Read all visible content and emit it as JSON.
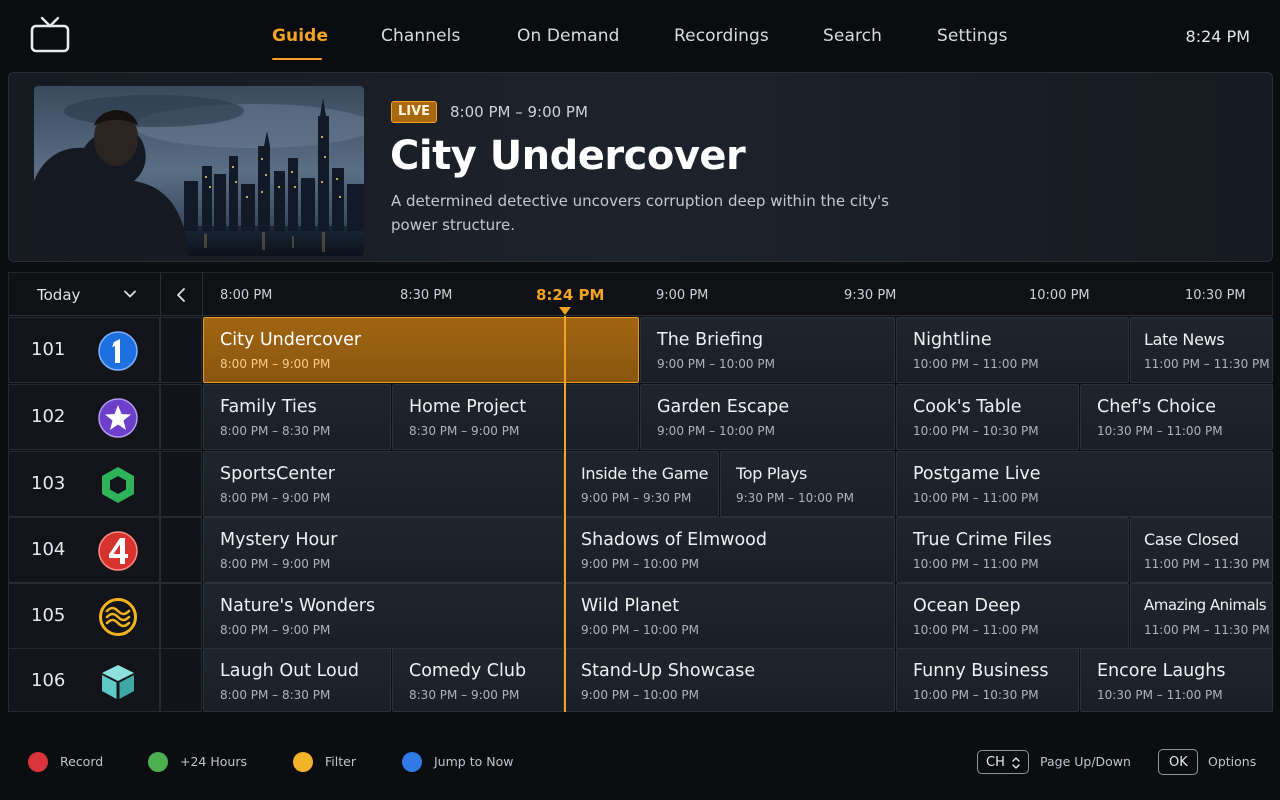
{
  "app": {
    "icon": "tv-icon",
    "clock": "8:24 PM"
  },
  "nav": {
    "items": [
      {
        "label": "Guide",
        "active": true
      },
      {
        "label": "Channels",
        "active": false
      },
      {
        "label": "On Demand",
        "active": false
      },
      {
        "label": "Recordings",
        "active": false
      },
      {
        "label": "Search",
        "active": false
      },
      {
        "label": "Settings",
        "active": false
      }
    ]
  },
  "featured": {
    "badge": "LIVE",
    "time": "8:00 PM – 9:00 PM",
    "title": "City Undercover",
    "description": "A determined detective uncovers corruption deep within the city's power structure."
  },
  "guide": {
    "day": "Today",
    "time_slots": [
      "8:00 PM",
      "8:30 PM",
      "9:00 PM",
      "9:30 PM",
      "10:00 PM",
      "10:30 PM"
    ],
    "now_label": "8:24 PM",
    "channels": [
      {
        "number": "101",
        "logo": "channel-1-logo",
        "logo_color": "#1e6fe0",
        "programs": [
          {
            "title": "City Undercover",
            "time": "8:00 PM – 9:00 PM",
            "selected": true
          },
          {
            "title": "The Briefing",
            "time": "9:00 PM – 10:00 PM"
          },
          {
            "title": "Nightline",
            "time": "10:00 PM – 11:00 PM"
          },
          {
            "title": "Late News",
            "time": "11:00 PM – 11:30 PM"
          }
        ]
      },
      {
        "number": "102",
        "logo": "star-channel-logo",
        "logo_color": "#6b3fc9",
        "programs": [
          {
            "title": "Family Ties",
            "time": "8:00 PM – 8:30 PM"
          },
          {
            "title": "Home Project",
            "time": "8:30 PM – 9:00 PM"
          },
          {
            "title": "Garden Escape",
            "time": "9:00 PM – 10:00 PM"
          },
          {
            "title": "Cook's Table",
            "time": "10:00 PM – 10:30 PM"
          },
          {
            "title": "Chef's Choice",
            "time": "10:30 PM – 11:00 PM"
          }
        ]
      },
      {
        "number": "103",
        "logo": "hexagon-channel-logo",
        "logo_color": "#2fb35a",
        "programs": [
          {
            "title": "SportsCenter",
            "time": "8:00 PM – 9:00 PM"
          },
          {
            "title": "Inside the Game",
            "time": "9:00 PM – 9:30 PM"
          },
          {
            "title": "Top Plays",
            "time": "9:30 PM – 10:00 PM"
          },
          {
            "title": "Postgame Live",
            "time": "10:00 PM – 11:00 PM"
          }
        ]
      },
      {
        "number": "104",
        "logo": "channel-4-logo",
        "logo_color": "#d6322e",
        "programs": [
          {
            "title": "Mystery Hour",
            "time": "8:00 PM – 9:00 PM"
          },
          {
            "title": "Shadows of Elmwood",
            "time": "9:00 PM – 10:00 PM"
          },
          {
            "title": "True Crime Files",
            "time": "10:00 PM – 11:00 PM"
          },
          {
            "title": "Case Closed",
            "time": "11:00 PM – 11:30 PM"
          }
        ]
      },
      {
        "number": "105",
        "logo": "waves-channel-logo",
        "logo_color": "#f2b320",
        "programs": [
          {
            "title": "Nature's Wonders",
            "time": "8:00 PM – 9:00 PM"
          },
          {
            "title": "Wild Planet",
            "time": "9:00 PM – 10:00 PM"
          },
          {
            "title": "Ocean Deep",
            "time": "10:00 PM – 11:00 PM"
          },
          {
            "title": "Amazing Animals",
            "time": "11:00 PM – 11:30 PM"
          }
        ]
      },
      {
        "number": "106",
        "logo": "cube-channel-logo",
        "logo_color": "#5fc9c6",
        "programs": [
          {
            "title": "Laugh Out Loud",
            "time": "8:00 PM – 8:30 PM"
          },
          {
            "title": "Comedy Club",
            "time": "8:30 PM – 9:00 PM"
          },
          {
            "title": "Stand-Up Showcase",
            "time": "9:00 PM – 10:00 PM"
          },
          {
            "title": "Funny Business",
            "time": "10:00 PM – 10:30 PM"
          },
          {
            "title": "Encore Laughs",
            "time": "10:30 PM – 11:00 PM"
          }
        ]
      }
    ]
  },
  "footer": {
    "hints": [
      {
        "color": "#d9353a",
        "label": "Record"
      },
      {
        "color": "#4caf50",
        "label": "+24 Hours"
      },
      {
        "color": "#f2b329",
        "label": "Filter"
      },
      {
        "color": "#2f7ae5",
        "label": "Jump to Now"
      }
    ],
    "ch_key": "CH",
    "ch_label": "Page Up/Down",
    "ok_key": "OK",
    "ok_label": "Options"
  }
}
